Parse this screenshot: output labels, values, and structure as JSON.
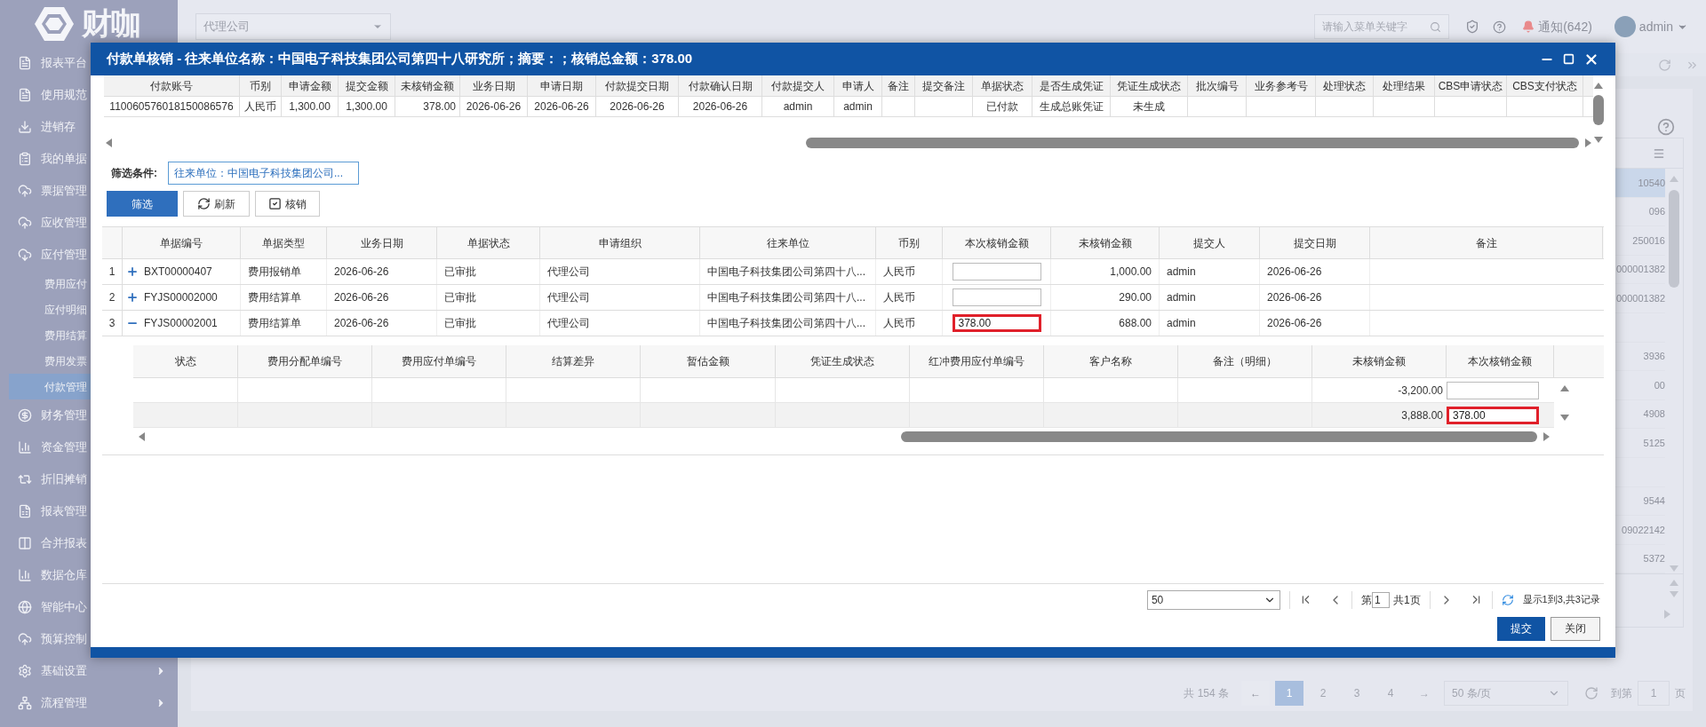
{
  "app": {
    "logo": "财咖",
    "company_select": "代理公司",
    "search": {
      "placeholder": "请输入菜单关键字"
    },
    "notifications": "通知(642)",
    "user": "admin"
  },
  "sidebar": {
    "items": [
      {
        "label": "报表平台",
        "selected": false
      },
      {
        "label": "使用规范",
        "selected": false
      },
      {
        "label": "进销存",
        "selected": false
      },
      {
        "label": "我的单据",
        "selected": false
      },
      {
        "label": "票据管理",
        "selected": false
      },
      {
        "label": "应收管理",
        "selected": false
      },
      {
        "label": "应付管理",
        "selected": false,
        "children": [
          {
            "label": "费用应付",
            "selected": false
          },
          {
            "label": "应付明细",
            "selected": false
          },
          {
            "label": "费用结算",
            "selected": false
          },
          {
            "label": "费用发票",
            "selected": false
          },
          {
            "label": "付款管理",
            "selected": true
          }
        ]
      },
      {
        "label": "财务管理",
        "selected": false
      },
      {
        "label": "资金管理",
        "selected": false
      },
      {
        "label": "折旧摊销",
        "selected": false
      },
      {
        "label": "报表管理",
        "selected": false
      },
      {
        "label": "合并报表",
        "selected": false
      },
      {
        "label": "数据仓库",
        "selected": false
      },
      {
        "label": "智能中心",
        "selected": false
      },
      {
        "label": "预算控制",
        "selected": false
      },
      {
        "label": "基础设置",
        "selected": false,
        "submenu": true
      },
      {
        "label": "流程管理",
        "selected": false,
        "submenu": true
      }
    ]
  },
  "background_list": {
    "rows": [
      {
        "text": "10540",
        "selected": true
      },
      {
        "text": "096",
        "selected": false
      },
      {
        "text": "250016",
        "selected": false
      },
      {
        "text": "000001382",
        "selected": false
      },
      {
        "text": "000001382",
        "selected": false
      },
      {
        "selected": false
      },
      {
        "text": "3936",
        "selected": false
      },
      {
        "text": "00",
        "selected": false
      },
      {
        "text": "4908",
        "selected": false
      },
      {
        "text": "5125",
        "selected": false
      },
      {
        "selected": false
      },
      {
        "text": "9544",
        "selected": false
      },
      {
        "text": "09022142",
        "selected": false
      },
      {
        "text": "5372",
        "selected": false
      }
    ]
  },
  "background_pager": {
    "total": "共 154 条",
    "prev": "←",
    "pages": [
      {
        "label": "1",
        "selected": true
      },
      {
        "label": "2",
        "selected": false
      },
      {
        "label": "3",
        "selected": false
      },
      {
        "label": "4",
        "selected": false
      }
    ],
    "next": "→",
    "page_size": "50 条/页",
    "goto_label": "到第",
    "goto_value": "1",
    "page_unit": "页"
  },
  "modal": {
    "title": "付款单核销 - 往来单位名称：中国电子科技集团公司第四十八研究所；摘要：；核销总金额：378.00",
    "payment_table": {
      "columns": [
        "付款账号",
        "币别",
        "申请金额",
        "提交金额",
        "未核销金额",
        "业务日期",
        "申请日期",
        "付款提交日期",
        "付款确认日期",
        "付款提交人",
        "申请人",
        "备注",
        "提交备注",
        "单据状态",
        "是否生成凭证",
        "凭证生成状态",
        "批次编号",
        "业务参考号",
        "处理状态",
        "处理结果",
        "CBS申请状态",
        "CBS支付状态"
      ],
      "rows": [
        [
          "110060576018150086576",
          "人民币",
          "1,300.00",
          "1,300.00",
          "378.00",
          "2026-06-26",
          "2026-06-26",
          "2026-06-26",
          "2026-06-26",
          "admin",
          "admin",
          "",
          "",
          "已付款",
          "生成总账凭证",
          "未生成",
          "",
          "",
          "",
          "",
          "",
          ""
        ]
      ]
    },
    "filter": {
      "label": "筛选条件:",
      "value": "往来单位：中国电子科技集团公司..."
    },
    "toolbar": [
      {
        "label": "筛选",
        "kind": "primary"
      },
      {
        "label": "刷新",
        "kind": "refresh"
      },
      {
        "label": "核销",
        "kind": "check"
      }
    ],
    "grid": {
      "columns": [
        "单据编号",
        "单据类型",
        "业务日期",
        "单据状态",
        "申请组织",
        "往来单位",
        "币别",
        "本次核销金额",
        "未核销金额",
        "提交人",
        "提交日期",
        "备注"
      ],
      "rows": [
        {
          "index": "1",
          "expanded": false,
          "number": "BXT00000407",
          "type": "费用报销单",
          "date": "2026-06-26",
          "status": "已审批",
          "org": "代理公司",
          "partner": "中国电子科技集团公司第四十八...",
          "currency": "人民币",
          "highlighted": false,
          "remaining": "1,000.00",
          "submitter": "admin",
          "submit_date": "2026-06-26"
        },
        {
          "index": "2",
          "expanded": false,
          "number": "FYJS00002000",
          "type": "费用结算单",
          "date": "2026-06-26",
          "status": "已审批",
          "org": "代理公司",
          "partner": "中国电子科技集团公司第四十八...",
          "currency": "人民币",
          "highlighted": false,
          "remaining": "290.00",
          "submitter": "admin",
          "submit_date": "2026-06-26"
        },
        {
          "index": "3",
          "expanded": true,
          "number": "FYJS00002001",
          "type": "费用结算单",
          "date": "2026-06-26",
          "status": "已审批",
          "org": "代理公司",
          "partner": "中国电子科技集团公司第四十八...",
          "currency": "人民币",
          "amount": "378.00",
          "highlighted": true,
          "remaining": "688.00",
          "submitter": "admin",
          "submit_date": "2026-06-26",
          "detail": {
            "columns": [
              "状态",
              "费用分配单编号",
              "费用应付单编号",
              "结算差异",
              "暂估金额",
              "凭证生成状态",
              "红冲费用应付单编号",
              "客户名称",
              "备注（明细）",
              "未核销金额",
              "本次核销金额"
            ],
            "rows": [
              {
                "remaining": "-3,200.00",
                "highlighted": false,
                "selected": false
              },
              {
                "remaining": "3,888.00",
                "amount": "378.00",
                "highlighted": true,
                "selected": true
              }
            ]
          }
        }
      ]
    },
    "pager": {
      "page_size": "50",
      "page_prefix": "第",
      "page_value": "1",
      "page_total": "共1页",
      "summary": "显示1到3,共3记录"
    },
    "buttons": [
      {
        "label": "提交",
        "kind": "primary"
      },
      {
        "label": "关闭",
        "kind": "default"
      }
    ]
  }
}
